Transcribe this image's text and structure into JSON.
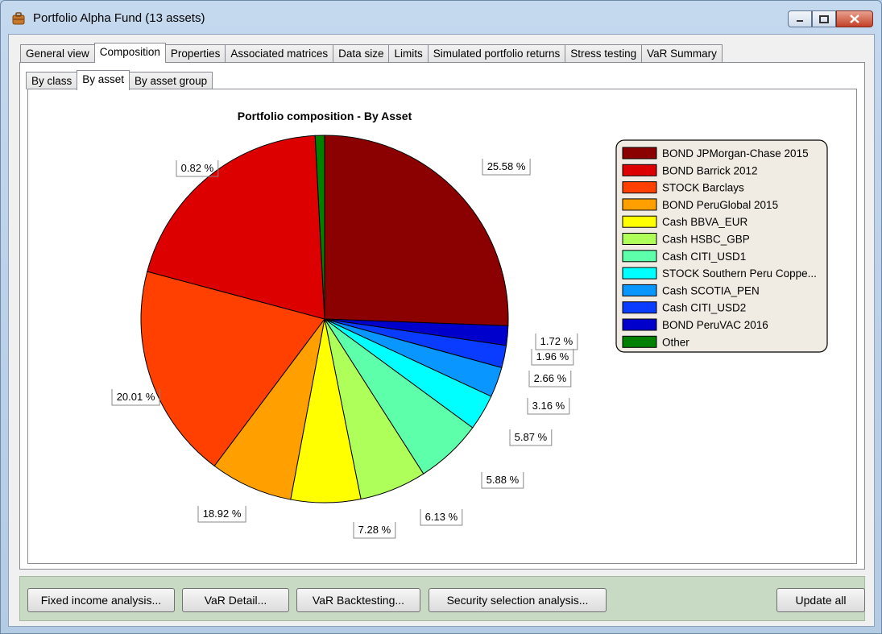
{
  "window": {
    "title": "Portfolio Alpha Fund (13 assets)"
  },
  "tabs": [
    "General view",
    "Composition",
    "Properties",
    "Associated matrices",
    "Data size",
    "Limits",
    "Simulated portfolio returns",
    "Stress testing",
    "VaR Summary"
  ],
  "active_tab": "Composition",
  "subtabs": [
    "By class",
    "By asset",
    "By asset group"
  ],
  "active_subtab": "By asset",
  "buttons": {
    "fixed_income": "Fixed income analysis...",
    "var_detail": "VaR Detail...",
    "var_backtesting": "VaR Backtesting...",
    "security_selection": "Security selection analysis...",
    "update_all": "Update all"
  },
  "chart_data": {
    "type": "pie",
    "title": "Portfolio composition - By Asset",
    "legend_position": "right",
    "slices": [
      {
        "label": "BOND JPMorgan-Chase 2015",
        "value": 25.58,
        "pct_label": "25.58 %",
        "color": "#8b0000"
      },
      {
        "label": "BOND PeruVAC 2016",
        "value": 1.72,
        "pct_label": "1.72 %",
        "color": "#0000cd"
      },
      {
        "label": "Cash CITI_USD2",
        "value": 1.96,
        "pct_label": "1.96 %",
        "color": "#0a3cff"
      },
      {
        "label": "Cash SCOTIA_PEN",
        "value": 2.66,
        "pct_label": "2.66 %",
        "color": "#0a96ff"
      },
      {
        "label": "STOCK Southern Peru Coppe...",
        "value": 3.16,
        "pct_label": "3.16 %",
        "color": "#00ffff"
      },
      {
        "label": "Cash CITI_USD1",
        "value": 5.87,
        "pct_label": "5.87 %",
        "color": "#5effaa"
      },
      {
        "label": "Cash HSBC_GBP",
        "value": 5.88,
        "pct_label": "5.88 %",
        "color": "#afff5a"
      },
      {
        "label": "Cash BBVA_EUR",
        "value": 6.13,
        "pct_label": "6.13 %",
        "color": "#ffff00"
      },
      {
        "label": "BOND PeruGlobal 2015",
        "value": 7.28,
        "pct_label": "7.28 %",
        "color": "#ffa000"
      },
      {
        "label": "STOCK Barclays",
        "value": 18.92,
        "pct_label": "18.92 %",
        "color": "#ff4000"
      },
      {
        "label": "BOND Barrick 2012",
        "value": 20.01,
        "pct_label": "20.01 %",
        "color": "#dc0000"
      },
      {
        "label": "Other",
        "value": 0.82,
        "pct_label": "0.82 %",
        "color": "#008000"
      }
    ],
    "legend_order": [
      "BOND JPMorgan-Chase 2015",
      "BOND Barrick 2012",
      "STOCK Barclays",
      "BOND PeruGlobal 2015",
      "Cash BBVA_EUR",
      "Cash HSBC_GBP",
      "Cash CITI_USD1",
      "STOCK Southern Peru Coppe...",
      "Cash SCOTIA_PEN",
      "Cash CITI_USD2",
      "BOND PeruVAC 2016",
      "Other"
    ]
  }
}
